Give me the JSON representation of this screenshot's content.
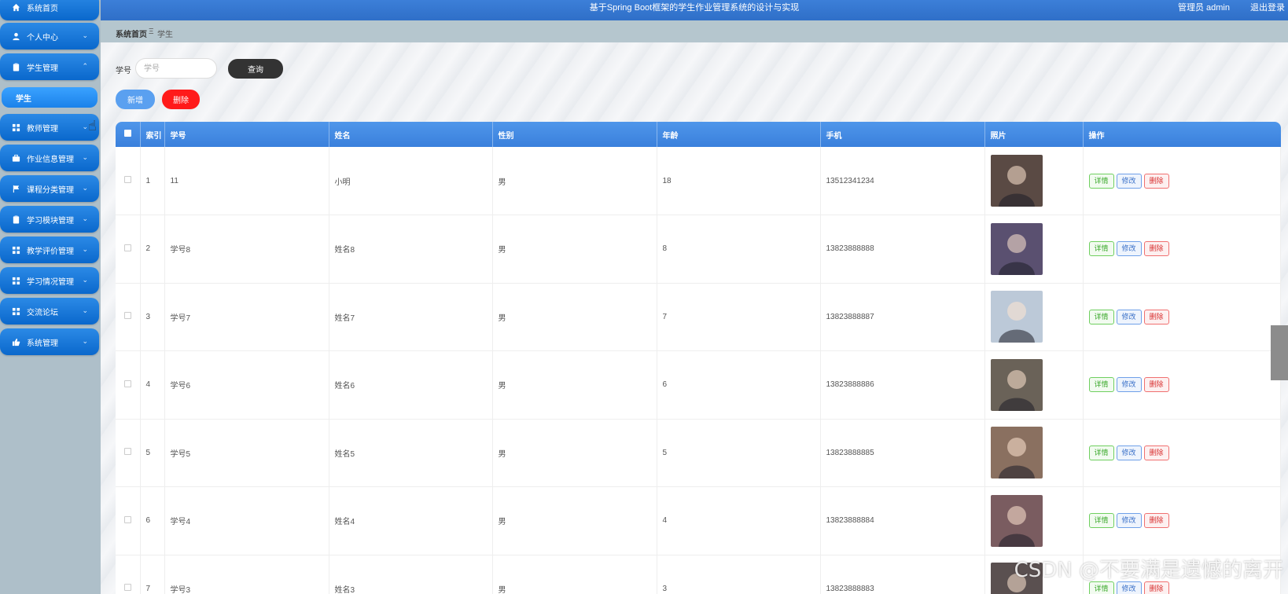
{
  "header": {
    "title": "基于Spring Boot框架的学生作业管理系统的设计与实现",
    "user": "管理员 admin",
    "logout": "退出登录"
  },
  "breadcrumb": {
    "home": "系统首页",
    "separator": "Ξ",
    "current": "学生"
  },
  "sidebar": {
    "items": [
      {
        "label": "系统首页",
        "icon": "home-icon"
      },
      {
        "label": "个人中心",
        "icon": "user-icon"
      },
      {
        "label": "学生管理",
        "icon": "clipboard-icon",
        "expanded": true,
        "sub": "学生"
      },
      {
        "label": "教师管理",
        "icon": "grid-icon"
      },
      {
        "label": "作业信息管理",
        "icon": "briefcase-icon"
      },
      {
        "label": "课程分类管理",
        "icon": "flag-icon"
      },
      {
        "label": "学习模块管理",
        "icon": "clipboard-icon"
      },
      {
        "label": "教学评价管理",
        "icon": "grid-icon"
      },
      {
        "label": "学习情况管理",
        "icon": "grid-icon"
      },
      {
        "label": "交流论坛",
        "icon": "grid-icon"
      },
      {
        "label": "系统管理",
        "icon": "thumbs-up-icon"
      }
    ]
  },
  "search": {
    "label": "学号",
    "placeholder": "学号",
    "query_button": "查询"
  },
  "actions": {
    "add": "新增",
    "delete": "删除"
  },
  "table": {
    "columns": [
      "",
      "索引",
      "学号",
      "姓名",
      "性别",
      "年龄",
      "手机",
      "照片",
      "操作"
    ],
    "rows": [
      {
        "index": "1",
        "xuehao": "11",
        "name": "小明",
        "gender": "男",
        "age": "18",
        "phone": "13512341234",
        "photo_color": "#5a4a44"
      },
      {
        "index": "2",
        "xuehao": "学号8",
        "name": "姓名8",
        "gender": "男",
        "age": "8",
        "phone": "13823888888",
        "photo_color": "#5a5070"
      },
      {
        "index": "3",
        "xuehao": "学号7",
        "name": "姓名7",
        "gender": "男",
        "age": "7",
        "phone": "13823888887",
        "photo_color": "#bcc9d8"
      },
      {
        "index": "4",
        "xuehao": "学号6",
        "name": "姓名6",
        "gender": "男",
        "age": "6",
        "phone": "13823888886",
        "photo_color": "#6a6258"
      },
      {
        "index": "5",
        "xuehao": "学号5",
        "name": "姓名5",
        "gender": "男",
        "age": "5",
        "phone": "13823888885",
        "photo_color": "#8a7060"
      },
      {
        "index": "6",
        "xuehao": "学号4",
        "name": "姓名4",
        "gender": "男",
        "age": "4",
        "phone": "13823888884",
        "photo_color": "#7a5c60"
      },
      {
        "index": "7",
        "xuehao": "学号3",
        "name": "姓名3",
        "gender": "男",
        "age": "3",
        "phone": "13823888883",
        "photo_color": "#5a5050"
      }
    ],
    "ops": {
      "detail": "详情",
      "edit": "修改",
      "delete": "删除"
    }
  },
  "watermark": "CSDN @不要满是遗憾的离开"
}
